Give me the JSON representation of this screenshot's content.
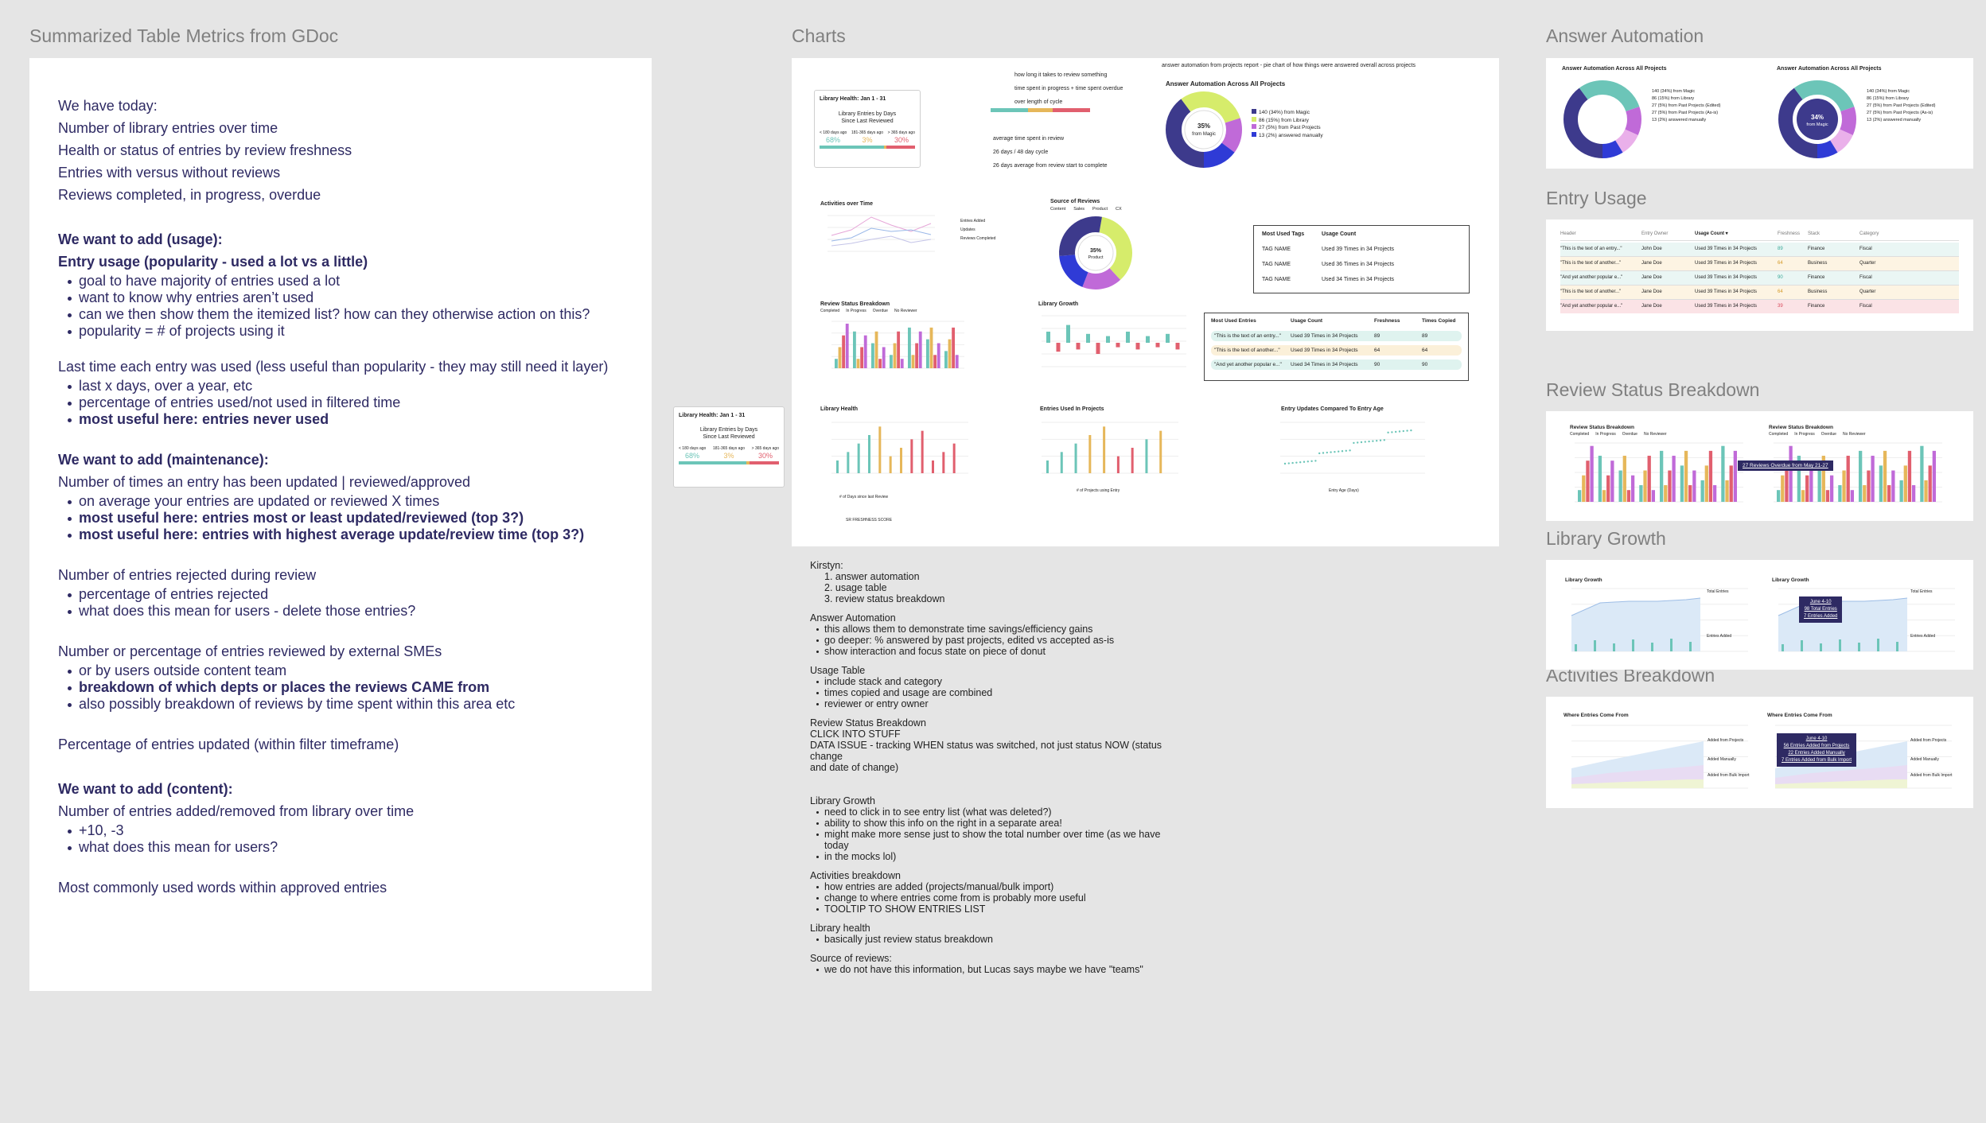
{
  "frames": {
    "doc": "Summarized Table Metrics from GDoc",
    "charts": "Charts",
    "answer_automation": "Answer Automation",
    "entry_usage": "Entry Usage",
    "review_status": "Review Status Breakdown",
    "library_growth": "Library Growth",
    "activities": "Activities Breakdown"
  },
  "doc": {
    "today_heading": "We have today:",
    "today_items": [
      "Number of library entries over time",
      "Health or status of entries by review freshness",
      "Entries with versus without reviews",
      "Reviews completed, in progress, overdue"
    ],
    "usage_heading": "We want to add (usage):",
    "usage_sub": "Entry usage (popularity - used a lot vs a little)",
    "usage_bullets": [
      "goal to have majority of entries used a lot",
      "want to know why entries aren’t used",
      "can we then show them the itemized list? how can they otherwise action on this?",
      "popularity = # of projects using it"
    ],
    "last_time": "Last time each entry was used (less useful than popularity - they may still need it layer)",
    "last_time_bullets": [
      "last x days, over a year, etc",
      "percentage of entries used/not used in filtered time",
      "most useful here: entries never used"
    ],
    "maint_heading": "We want to add (maintenance):",
    "maint_sub": "Number of times an entry has been updated | reviewed/approved",
    "maint_bullets": [
      "on average your entries are updated or reviewed X times",
      "most useful here: entries most or least updated/reviewed (top 3?)",
      "most useful here: entries with highest average update/review time (top 3?)"
    ],
    "rejected": "Number of entries rejected during review",
    "rejected_bullets": [
      "percentage of entries rejected",
      "what does this mean for users - delete those entries?"
    ],
    "smes": "Number or percentage of entries reviewed by external SMEs",
    "smes_bullets": [
      "or by users outside content team",
      "breakdown of which depts or places the reviews CAME from",
      "also possibly breakdown of reviews by time spent within this area etc"
    ],
    "pct_updated": "Percentage of entries updated (within filter timeframe)",
    "content_heading": "We want to add (content):",
    "content_sub": "Number of entries added/removed from library over time",
    "content_bullets": [
      "+10, -3",
      "what does this mean for users?"
    ],
    "common_words": "Most commonly used words within approved entries"
  },
  "library_health": {
    "title": "Library Health: Jan 1 - 31",
    "sub1": "Library Entries by Days",
    "sub2": "Since Last Reviewed",
    "legend": [
      "< 180 days ago",
      "181-365 days ago",
      "> 365 days ago"
    ],
    "pcts": [
      "68%",
      "3%",
      "30%"
    ]
  },
  "charts_notes": {
    "top_mid": [
      "how long it takes to review something",
      "time spent in progress + time spent overdue",
      "over length of cycle"
    ],
    "top_mid2": [
      "average time spent in review",
      "26 days / 48 day cycle",
      "26 days average from review start to complete"
    ],
    "aa_note": "answer automation from projects report - pie chart of how things were answered overall across projects",
    "aa_title": "Answer Automation Across All Projects",
    "donut_center": [
      "35%",
      "from Magic"
    ],
    "aa_legend": [
      "140 (34%) from Magic",
      "86 (15%) from Library",
      "27 (5%) from Past Projects",
      "13 (2%) answered manually"
    ],
    "activities": "Activities over Time",
    "act_legend": [
      "Entries Added",
      "Updates",
      "Reviews Completed"
    ],
    "sources": "Source of Reviews",
    "sources_legend": [
      "Content",
      "Sales",
      "Product",
      "CX"
    ],
    "sources_center": [
      "35%",
      "Product"
    ],
    "most_used_tags": "Most Used Tags",
    "usage_count": "Usage Count",
    "tags": [
      [
        "TAG NAME",
        "Used 39 Times in 34 Projects"
      ],
      [
        "TAG NAME",
        "Used 36 Times in 34 Projects"
      ],
      [
        "TAG NAME",
        "Used 34 Times in 34 Projects"
      ]
    ],
    "rsb": "Review Status Breakdown",
    "rsb_legend": [
      "Completed",
      "In Progress",
      "Overdue",
      "No Reviewer"
    ],
    "lib_growth": "Library Growth",
    "mue_headers": [
      "Most Used Entries",
      "Usage Count",
      "Freshness",
      "Times Copied"
    ],
    "mue_rows": [
      [
        "\"This is the text of an entry...\"",
        "Used 39 Times in 34 Projects",
        "89",
        "89"
      ],
      [
        "\"This is the text of another...\"",
        "Used 39 Times in 34 Projects",
        "64",
        "64"
      ],
      [
        "\"And yet another popular e...\"",
        "Used 34 Times in 34 Projects",
        "90",
        "90"
      ]
    ],
    "lib_health": "Library Health",
    "entries_used": "Entries Used In Projects",
    "entry_updates": "Entry Updates Compared To Entry Age",
    "x_days": "# of Days since last Review",
    "x_projects": "# of Projects using Entry",
    "x_age": "Entry Age (Days)",
    "sr_score": "SR FRESHNESS SCORE"
  },
  "kirstyn": {
    "name": "Kirstyn:",
    "ordered": [
      "answer automation",
      "usage table",
      "review status breakdown"
    ],
    "aa": "Answer Automation",
    "aa_items": [
      "this allows them to demonstrate time savings/efficiency gains",
      "go deeper: % answered by past projects, edited vs accepted as-is",
      "show interaction and focus state on piece of donut"
    ],
    "ut": "Usage Table",
    "ut_items": [
      "include stack and category",
      "times copied and usage are combined",
      "reviewer or entry owner"
    ],
    "rsb": "Review Status Breakdown",
    "rsb_lines": [
      "CLICK INTO STUFF",
      "DATA ISSUE - tracking WHEN status was switched, not just status NOW (status change",
      "and date of change)"
    ],
    "lg": "Library Growth",
    "lg_items": [
      "need to click in to see entry list (what was deleted?)",
      "ability to show this info on the right in a separate area!",
      "might make more sense just to show the total number over time (as we have today",
      "in the mocks lol)"
    ],
    "ab": "Activities breakdown",
    "ab_items": [
      "how entries are added (projects/manual/bulk import)",
      "change to where entries come from is probably more useful",
      "TOOLTIP TO SHOW ENTRIES LIST"
    ],
    "lh": "Library health",
    "lh_items": [
      "basically just review status breakdown"
    ],
    "sr": "Source of reviews:",
    "sr_items": [
      "we do not have this information, but Lucas says maybe we have \"teams\""
    ]
  },
  "right": {
    "aa_title": "Answer Automation Across All Projects",
    "aa_legend1": [
      "140 (34%) from Magic",
      "86 (15%) from Library",
      "27 (5%) from Past Projects (Edited)",
      "27 (5%) from Past Projects (As-is)",
      "13 (2%) answered manually"
    ],
    "aa_legend2": [
      "140 (34%) from Magic",
      "86 (15%) from Library",
      "27 (5%) from Past Projects (Edited)",
      "27 (5%) from Past Projects (As-is)",
      "13 (2%) answered manually"
    ],
    "donut2_center": [
      "34%",
      "from Magic"
    ],
    "eu_headers": [
      "Header",
      "Entry Owner",
      "Usage Count ▾",
      "Freshness",
      "Stack",
      "Category"
    ],
    "eu_rows": [
      [
        "\"This is the text of an entry...\"",
        "John Doe",
        "Used 39 Times in 34 Projects",
        "89",
        "Finance",
        "Fiscal"
      ],
      [
        "\"This is the text of another...\"",
        "Jane Doe",
        "Used 39 Times in 34 Projects",
        "64",
        "Business",
        "Quarter"
      ],
      [
        "\"And yet another popular e...\"",
        "Jane Doe",
        "Used 39 Times in 34 Projects",
        "90",
        "Finance",
        "Fiscal"
      ],
      [
        "\"This is the text of another...\"",
        "Jane Doe",
        "Used 39 Times in 34 Projects",
        "64",
        "Business",
        "Quarter"
      ],
      [
        "\"And yet another popular e...\"",
        "Jane Doe",
        "Used 39 Times in 34 Projects",
        "39",
        "Finance",
        "Fiscal"
      ]
    ],
    "rsb_tooltip": "27 Reviews Overdue from May 21-27",
    "lg_title": "Library Growth",
    "lg_tooltip": [
      "June 4-10",
      "98 Total Entries",
      "7 Entries Added"
    ],
    "lg_labels": [
      "Total Entries",
      "Entries Added"
    ],
    "ab_title": "Where Entries Come From",
    "ab_labels": [
      "Added from Projects",
      "Added Manually",
      "Added from Bulk Import"
    ],
    "ab_tooltip": [
      "June 4-10",
      "56 Entries Added from Projects",
      "22 Entries Added Manually",
      "7 Entries Added from Bulk Import"
    ]
  },
  "colors": {
    "navy": "#2e2a63",
    "teal": "#6cc5b8",
    "yellow": "#e6b75a",
    "red": "#e15f6e",
    "lime": "#d6ec6b",
    "purple": "#3d3a8c",
    "blue": "#2f3bd6",
    "violet": "#c06ad8"
  }
}
